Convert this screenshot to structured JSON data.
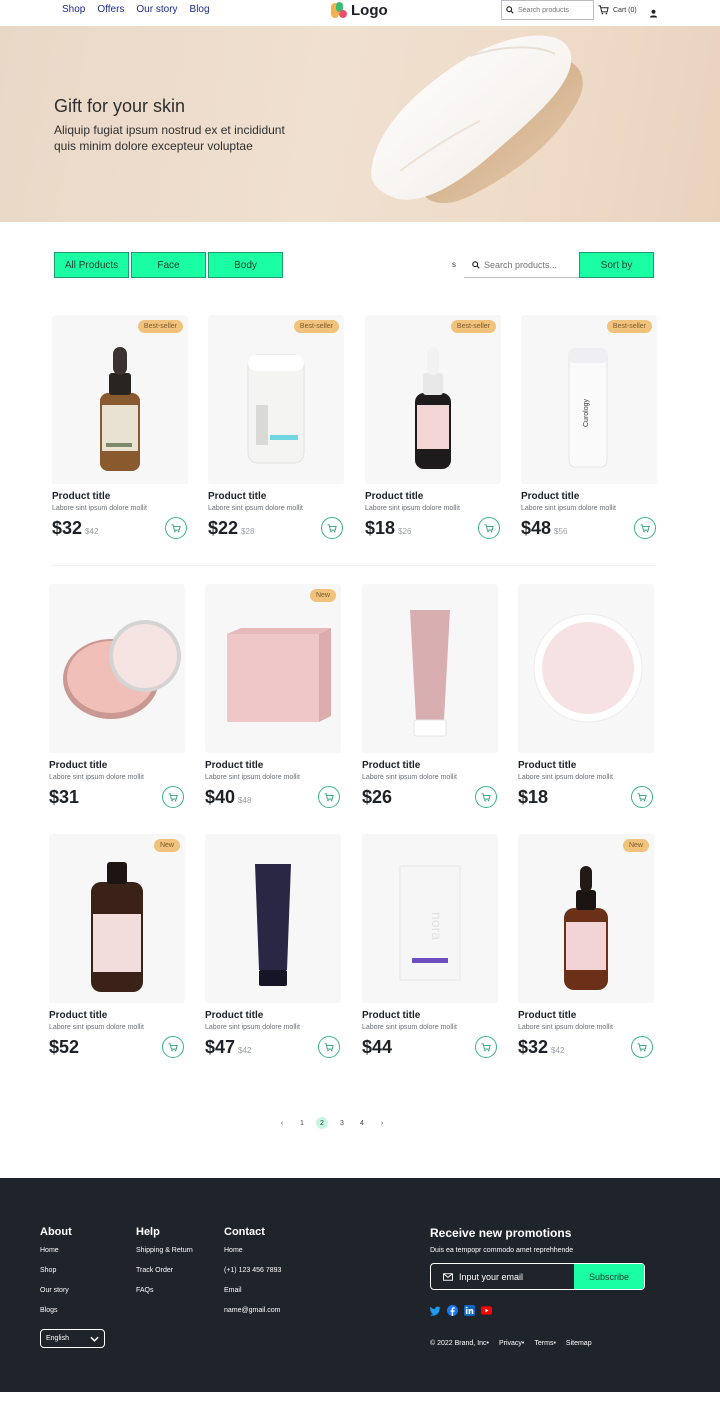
{
  "header": {
    "nav": [
      "Shop",
      "Offers",
      "Our story",
      "Blog"
    ],
    "logo_text": "Logo",
    "search_placeholder": "Search products",
    "cart_label": "Cart (0)"
  },
  "hero": {
    "title": "Gift for your skin",
    "subtitle": "Aliquip fugiat ipsum nostrud ex et incididunt quis minim dolore excepteur voluptae"
  },
  "filters": {
    "buttons": [
      "All Products",
      "Face",
      "Body"
    ],
    "s_label": "s",
    "search_placeholder": "Search products...",
    "sort_label": "Sort by"
  },
  "products": [
    {
      "title": "Product title",
      "desc": "Labore sint ipsum dolore mollit",
      "price": "$32",
      "old": "$42",
      "badge": "Best-seller",
      "kind": "dropper-brown"
    },
    {
      "title": "Product title",
      "desc": "Labore sint ipsum dolore mollit",
      "price": "$22",
      "old": "$28",
      "badge": "Best-seller",
      "kind": "jar-white"
    },
    {
      "title": "Product title",
      "desc": "Labore sint ipsum dolore mollit",
      "price": "$18",
      "old": "$26",
      "badge": "Best-seller",
      "kind": "dropper-dark"
    },
    {
      "title": "Product title",
      "desc": "Labore sint ipsum dolore mollit",
      "price": "$48",
      "old": "$56",
      "badge": "Best-seller",
      "kind": "bottle-white"
    },
    {
      "title": "Product title",
      "desc": "Labore sint ipsum dolore mollit",
      "price": "$31",
      "old": "",
      "badge": "",
      "kind": "tin-pink"
    },
    {
      "title": "Product title",
      "desc": "Labore sint ipsum dolore mollit",
      "price": "$40",
      "old": "$48",
      "badge": "New",
      "kind": "box-pink"
    },
    {
      "title": "Product title",
      "desc": "Labore sint ipsum dolore mollit",
      "price": "$26",
      "old": "",
      "badge": "",
      "kind": "tube-pink"
    },
    {
      "title": "Product title",
      "desc": "Labore sint ipsum dolore mollit",
      "price": "$18",
      "old": "",
      "badge": "",
      "kind": "dish-pink"
    },
    {
      "title": "Product title",
      "desc": "Labore sint ipsum dolore mollit",
      "price": "$52",
      "old": "",
      "badge": "New",
      "kind": "bottle-brown"
    },
    {
      "title": "Product title",
      "desc": "Labore sint ipsum dolore mollit",
      "price": "$47",
      "old": "$42",
      "badge": "",
      "kind": "tube-navy"
    },
    {
      "title": "Product title",
      "desc": "Labore sint ipsum dolore mollit",
      "price": "$44",
      "old": "",
      "badge": "",
      "kind": "box-white"
    },
    {
      "title": "Product title",
      "desc": "Labore sint ipsum dolore mollit",
      "price": "$32",
      "old": "$42",
      "badge": "New",
      "kind": "serum-brown"
    }
  ],
  "pagination": {
    "prev": "‹",
    "pages": [
      "1",
      "2",
      "3",
      "4"
    ],
    "current": "2",
    "next": "›"
  },
  "footer": {
    "about": {
      "heading": "About",
      "links": [
        "Home",
        "Shop",
        "Our story",
        "Blogs"
      ]
    },
    "help": {
      "heading": "Help",
      "links": [
        "Shipping & Return",
        "Track Order",
        "FAQs"
      ]
    },
    "contact": {
      "heading": "Contact",
      "links": [
        "Home",
        "(+1) 123 456 7893",
        "Email",
        "name@gmail.com"
      ]
    },
    "language": "English",
    "promo_title": "Receive new promotions",
    "promo_sub": "Duis ea tempopr commodo amet reprehhende",
    "email_placeholder": "Input your email",
    "subscribe_label": "Subscribe",
    "social": [
      "twitter-icon",
      "facebook-icon",
      "linkedin-icon",
      "youtube-icon"
    ],
    "copyright": "© 2022 Brand, Inc•",
    "bottom_links": [
      "Privacy•",
      "Terms•",
      "Sitemap"
    ]
  },
  "colors": {
    "accent": "#1affa3",
    "badge": "#f0c27b",
    "footer_bg": "#1f232a",
    "nav_text": "#1d2a8c"
  }
}
